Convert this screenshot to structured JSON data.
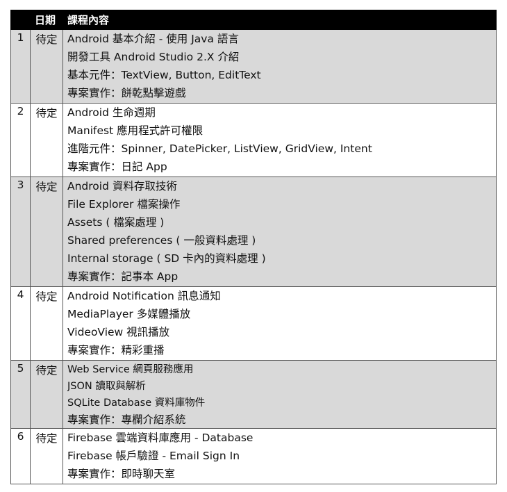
{
  "table": {
    "headers": {
      "num": "",
      "date": "日期",
      "content": "課程內容"
    },
    "rows": [
      {
        "num": "1",
        "date": "待定",
        "shaded": true,
        "small": false,
        "lines": [
          "Android 基本介紹 - 使用 Java 語言",
          "開發工具 Android Studio 2.X 介紹",
          "基本元件：TextView, Button, EditText",
          "專案實作：餅乾點擊遊戲"
        ]
      },
      {
        "num": "2",
        "date": "待定",
        "shaded": false,
        "small": false,
        "lines": [
          "Android 生命週期",
          "Manifest 應用程式許可權限",
          "進階元件：Spinner, DatePicker, ListView, GridView, Intent",
          "專案實作：日記 App"
        ]
      },
      {
        "num": "3",
        "date": "待定",
        "shaded": true,
        "small": false,
        "lines": [
          "Android 資料存取技術",
          "File Explorer 檔案操作",
          "Assets ( 檔案處理 )",
          "Shared preferences ( 一般資料處理 )",
          "Internal storage ( SD 卡內的資料處理 )",
          "專案實作：記事本 App"
        ]
      },
      {
        "num": "4",
        "date": "待定",
        "shaded": false,
        "small": false,
        "lines": [
          "Android Notification 訊息通知",
          "MediaPlayer 多媒體播放",
          "VideoView 視訊播放",
          "專案實作：精彩重播"
        ]
      },
      {
        "num": "5",
        "date": "待定",
        "shaded": true,
        "small": true,
        "lines": [
          "Web Service 網頁服務應用",
          "JSON 讀取與解析",
          "SQLite Database 資料庫物件",
          "專案實作：專欄介紹系統"
        ]
      },
      {
        "num": "6",
        "date": "待定",
        "shaded": false,
        "small": false,
        "lines": [
          "Firebase 雲端資料庫應用 - Database",
          "Firebase 帳戶驗證 - Email Sign In",
          "專案實作：即時聊天室"
        ]
      }
    ]
  }
}
